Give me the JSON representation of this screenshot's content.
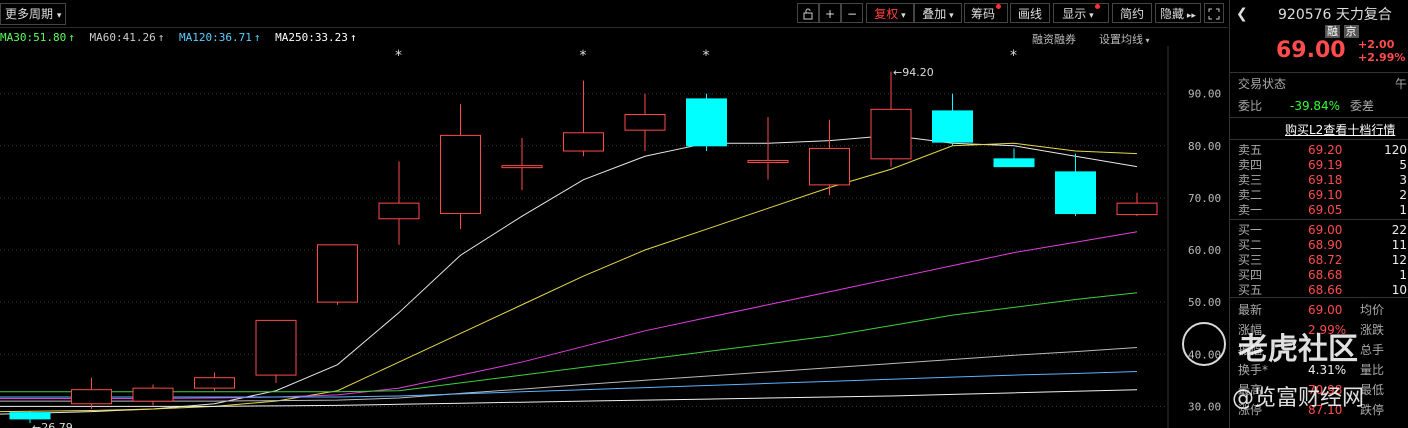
{
  "toolbar": {
    "period_label": "更多周期",
    "buttons": [
      {
        "label": "复权",
        "active": true,
        "dropdown": true
      },
      {
        "label": "叠加",
        "active": false,
        "dropdown": true
      },
      {
        "label": "筹码",
        "active": false,
        "dot": true
      },
      {
        "label": "画线",
        "active": false
      },
      {
        "label": "显示",
        "active": false,
        "dropdown": true,
        "dot": true
      },
      {
        "label": "简约",
        "active": false
      },
      {
        "label": "隐藏",
        "active": false
      }
    ]
  },
  "ma_legend": [
    {
      "label": "MA30:51.80",
      "color": "#5aff5a"
    },
    {
      "label": "MA60:41.26",
      "color": "#cccccc"
    },
    {
      "label": "MA120:36.71",
      "color": "#5ad0ff"
    },
    {
      "label": "MA250:33.23",
      "color": "#ffffff"
    }
  ],
  "ma_right": {
    "margin": "融资融券",
    "settings": "设置均线"
  },
  "chart_data": {
    "type": "candlestick",
    "ylim": [
      27,
      98
    ],
    "y_ticks": [
      "90.00",
      "80.00",
      "70.00",
      "60.00",
      "50.00",
      "40.00",
      "30.00"
    ],
    "y_tick_values": [
      90,
      80,
      70,
      60,
      50,
      40,
      30
    ],
    "high_label": "94.20",
    "low_label": "26.79",
    "candles": [
      {
        "o": 28.8,
        "c": 27.6,
        "h": 29.0,
        "l": 26.8
      },
      {
        "o": 30.5,
        "c": 33.2,
        "h": 35.5,
        "l": 29.5
      },
      {
        "o": 31.0,
        "c": 33.5,
        "h": 34.2,
        "l": 30.2
      },
      {
        "o": 33.5,
        "c": 35.5,
        "h": 36.5,
        "l": 33.0
      },
      {
        "o": 36.0,
        "c": 46.5,
        "h": 46.5,
        "l": 34.5
      },
      {
        "o": 50.0,
        "c": 61.0,
        "h": 61.0,
        "l": 49.5
      },
      {
        "o": 66.0,
        "c": 69.0,
        "h": 77.0,
        "l": 61.0
      },
      {
        "o": 67.0,
        "c": 82.0,
        "h": 88.0,
        "l": 64.0
      },
      {
        "o": 76.0,
        "c": 76.0,
        "h": 81.5,
        "l": 71.5
      },
      {
        "o": 79.0,
        "c": 82.5,
        "h": 92.5,
        "l": 78.0
      },
      {
        "o": 83.0,
        "c": 86.0,
        "h": 90.0,
        "l": 79.0
      },
      {
        "o": 89.0,
        "c": 80.0,
        "h": 90.0,
        "l": 79.0
      },
      {
        "o": 77.0,
        "c": 77.0,
        "h": 85.5,
        "l": 73.5
      },
      {
        "o": 72.5,
        "c": 79.5,
        "h": 85.0,
        "l": 70.5
      },
      {
        "o": 77.5,
        "c": 87.0,
        "h": 94.2,
        "l": 76.0
      },
      {
        "o": 86.7,
        "c": 80.7,
        "h": 90.0,
        "l": 80.0
      },
      {
        "o": 77.5,
        "c": 76.0,
        "h": 79.5,
        "l": 76.0
      },
      {
        "o": 75.0,
        "c": 67.0,
        "h": 78.5,
        "l": 66.5
      },
      {
        "o": 66.8,
        "c": 69.0,
        "h": 71.0,
        "l": 66.5
      }
    ],
    "ma_lines": [
      {
        "name": "white",
        "color": "#e8e8e8",
        "values": [
          28.5,
          29.0,
          29.5,
          30.5,
          33.0,
          38.0,
          48.0,
          59.0,
          66.5,
          73.5,
          78.0,
          80.5,
          80.5,
          81.0,
          82.0,
          80.5,
          80.0,
          78.0,
          76.0
        ]
      },
      {
        "name": "yellow",
        "color": "#e6d84a",
        "values": [
          29.0,
          29.2,
          29.5,
          30.0,
          31.0,
          33.0,
          38.5,
          44.0,
          49.5,
          55.0,
          60.0,
          64.0,
          68.0,
          72.0,
          75.5,
          80.0,
          80.5,
          79.0,
          78.5
        ]
      },
      {
        "name": "magenta",
        "color": "#e040e0",
        "values": [
          31.5,
          31.5,
          31.5,
          31.6,
          31.8,
          32.2,
          33.5,
          36.0,
          38.5,
          41.5,
          44.5,
          47.0,
          49.5,
          52.0,
          54.5,
          57.0,
          59.5,
          61.5,
          63.5
        ]
      },
      {
        "name": "green",
        "color": "#40d040",
        "values": [
          32.8,
          32.8,
          32.8,
          32.8,
          32.8,
          32.8,
          33.0,
          34.5,
          36.0,
          37.5,
          39.0,
          40.5,
          42.0,
          43.5,
          45.5,
          47.5,
          49.0,
          50.5,
          51.8
        ]
      },
      {
        "name": "gray",
        "color": "#bbbbbb",
        "values": [
          31.0,
          31.0,
          31.0,
          31.0,
          31.1,
          31.2,
          31.6,
          32.5,
          33.3,
          34.2,
          35.0,
          35.8,
          36.6,
          37.4,
          38.2,
          39.0,
          39.8,
          40.5,
          41.3
        ]
      },
      {
        "name": "cyan",
        "color": "#5ab4ff",
        "values": [
          31.8,
          31.8,
          31.8,
          31.8,
          31.8,
          31.8,
          32.0,
          32.4,
          32.8,
          33.2,
          33.6,
          34.0,
          34.4,
          34.8,
          35.2,
          35.6,
          36.0,
          36.3,
          36.7
        ]
      },
      {
        "name": "white2",
        "color": "#f0f0f0",
        "values": [
          30.0,
          30.0,
          30.0,
          30.0,
          30.1,
          30.2,
          30.4,
          30.6,
          30.8,
          31.0,
          31.2,
          31.4,
          31.6,
          31.8,
          32.0,
          32.3,
          32.6,
          32.9,
          33.2
        ]
      }
    ],
    "stars_at": [
      6,
      9,
      11,
      16
    ]
  },
  "panel": {
    "code": "920576",
    "name": "天力复合",
    "tags": [
      "融",
      "京"
    ],
    "price": "69.00",
    "change": "+2.00",
    "change_pct": "+2.99%",
    "status_label": "交易状态",
    "status_value": "午",
    "webi_label": "委比",
    "webi_value": "-39.84%",
    "weicha_label": "委差",
    "l2_link": "购买L2查看十档行情",
    "asks": [
      {
        "label": "卖五",
        "price": "69.20",
        "vol": "120"
      },
      {
        "label": "卖四",
        "price": "69.19",
        "vol": "5"
      },
      {
        "label": "卖三",
        "price": "69.18",
        "vol": "3"
      },
      {
        "label": "卖二",
        "price": "69.10",
        "vol": "2"
      },
      {
        "label": "卖一",
        "price": "69.05",
        "vol": "1"
      }
    ],
    "bids": [
      {
        "label": "买一",
        "price": "69.00",
        "vol": "22"
      },
      {
        "label": "买二",
        "price": "68.90",
        "vol": "11"
      },
      {
        "label": "买三",
        "price": "68.72",
        "vol": "12"
      },
      {
        "label": "买四",
        "price": "68.68",
        "vol": "1"
      },
      {
        "label": "买五",
        "price": "68.66",
        "vol": "10"
      }
    ],
    "stats": [
      {
        "l1": "最新",
        "v1": "69.00",
        "l2": "均价",
        "cls": "red"
      },
      {
        "l1": "涨幅",
        "v1": "2.99%",
        "l2": "涨跌",
        "cls": "red"
      },
      {
        "l1": "振幅",
        "v1": "",
        "l2": "总手",
        "cls": "red"
      },
      {
        "l1": "换手*",
        "v1": "4.31%",
        "l2": "量比",
        "cls": "white"
      },
      {
        "l1": "最高",
        "v1": "70.98",
        "l2": "最低",
        "cls": "red"
      },
      {
        "l1": "涨停",
        "v1": "87.10",
        "l2": "跌停",
        "cls": "red"
      }
    ]
  },
  "watermark": {
    "line1": "老虎社区",
    "line2": "@览富财经网"
  }
}
